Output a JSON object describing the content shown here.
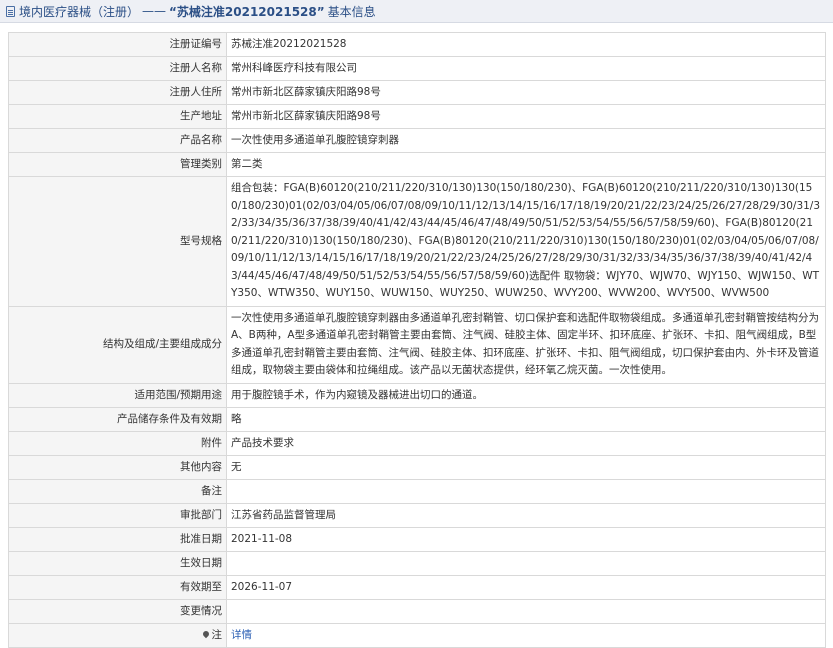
{
  "header": {
    "section": "境内医疗器械（注册）",
    "separator": "——",
    "record_title": "“苏械注准20212021528”",
    "suffix": "基本信息"
  },
  "rows": [
    {
      "label": "注册证编号",
      "value": "苏械注准20212021528"
    },
    {
      "label": "注册人名称",
      "value": "常州科峰医疗科技有限公司"
    },
    {
      "label": "注册人住所",
      "value": "常州市新北区薛家镇庆阳路98号"
    },
    {
      "label": "生产地址",
      "value": "常州市新北区薛家镇庆阳路98号"
    },
    {
      "label": "产品名称",
      "value": "一次性使用多通道单孔腹腔镜穿刺器"
    },
    {
      "label": "管理类别",
      "value": "第二类"
    },
    {
      "label": "型号规格",
      "value": "组合包装：FGA(B)60120(210/211/220/310/130)130(150/180/230)、FGA(B)60120(210/211/220/310/130)130(150/180/230)01(02/03/04/05/06/07/08/09/10/11/12/13/14/15/16/17/18/19/20/21/22/23/24/25/26/27/28/29/30/31/32/33/34/35/36/37/38/39/40/41/42/43/44/45/46/47/48/49/50/51/52/53/54/55/56/57/58/59/60)、FGA(B)80120(210/211/220/310)130(150/180/230)、FGA(B)80120(210/211/220/310)130(150/180/230)01(02/03/04/05/06/07/08/09/10/11/12/13/14/15/16/17/18/19/20/21/22/23/24/25/26/27/28/29/30/31/32/33/34/35/36/37/38/39/40/41/42/43/44/45/46/47/48/49/50/51/52/53/54/55/56/57/58/59/60)选配件 取物袋：WJY70、WJW70、WJY150、WJW150、WTY350、WTW350、WUY150、WUW150、WUY250、WUW250、WVY200、WVW200、WVY500、WVW500"
    },
    {
      "label": "结构及组成/主要组成成分",
      "value": "一次性使用多通道单孔腹腔镜穿刺器由多通道单孔密封鞘管、切口保护套和选配件取物袋组成。多通道单孔密封鞘管按结构分为A、B两种，A型多通道单孔密封鞘管主要由套筒、注气阀、硅胶主体、固定半环、扣环底座、扩张环、卡扣、阻气阀组成，B型多通道单孔密封鞘管主要由套筒、注气阀、硅胶主体、扣环底座、扩张环、卡扣、阻气阀组成，切口保护套由内、外卡环及管道组成，取物袋主要由袋体和拉绳组成。该产品以无菌状态提供，经环氧乙烷灭菌。一次性使用。"
    },
    {
      "label": "适用范围/预期用途",
      "value": "用于腹腔镜手术，作为内窥镜及器械进出切口的通道。"
    },
    {
      "label": "产品储存条件及有效期",
      "value": "略"
    },
    {
      "label": "附件",
      "value": "产品技术要求"
    },
    {
      "label": "其他内容",
      "value": "无"
    },
    {
      "label": "备注",
      "value": ""
    },
    {
      "label": "审批部门",
      "value": "江苏省药品监督管理局"
    },
    {
      "label": "批准日期",
      "value": "2021-11-08"
    },
    {
      "label": "生效日期",
      "value": ""
    },
    {
      "label": "有效期至",
      "value": "2026-11-07"
    },
    {
      "label": "变更情况",
      "value": ""
    }
  ],
  "footer_row": {
    "label": "注",
    "icon": "pin-icon",
    "link_text": "详情"
  }
}
